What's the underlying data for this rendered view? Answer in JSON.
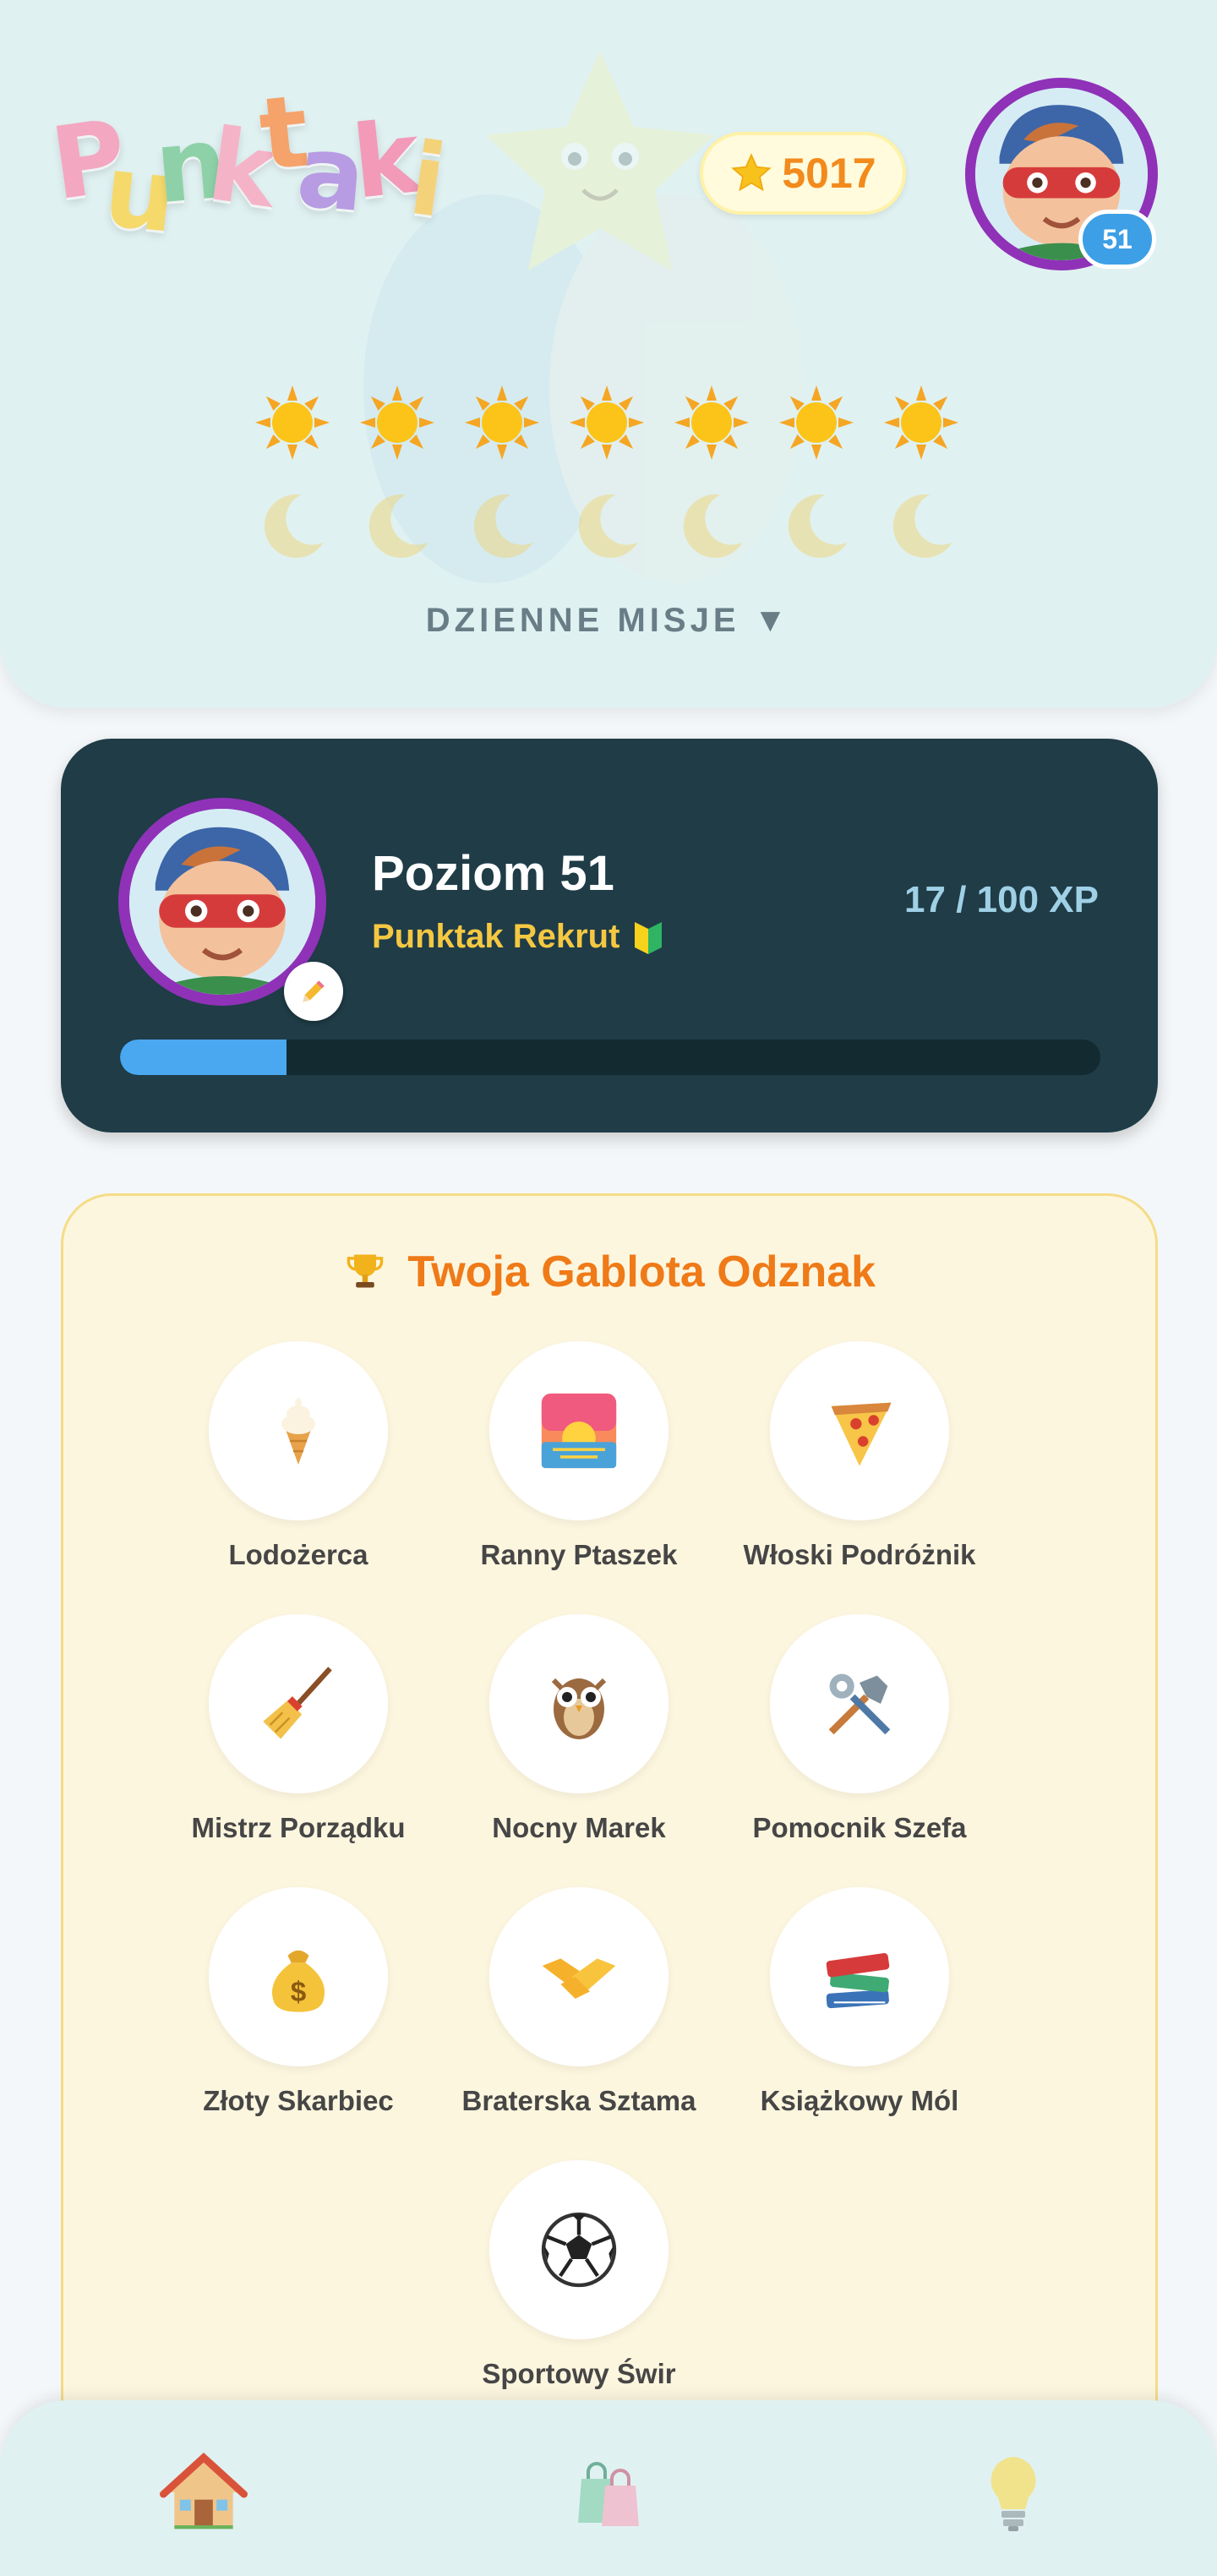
{
  "app": {
    "logo_text": "Punktaki"
  },
  "header": {
    "stars_value": "5017",
    "avatar_level": "51",
    "days_count": 7,
    "missions_label": "DZIENNE MISJE ▼"
  },
  "level_card": {
    "level_label": "Poziom 51",
    "rank_label": "Punktak Rekrut",
    "xp_label": "17 / 100 XP",
    "xp_progress": 0.17
  },
  "badges": {
    "title": "Twoja Gablota Odznak",
    "items": [
      {
        "label": "Lodożerca",
        "icon": "ice-cream-icon"
      },
      {
        "label": "Ranny Ptaszek",
        "icon": "sunrise-icon"
      },
      {
        "label": "Włoski Podróżnik",
        "icon": "pizza-icon"
      },
      {
        "label": "Mistrz Porządku",
        "icon": "broom-icon"
      },
      {
        "label": "Nocny Marek",
        "icon": "owl-icon"
      },
      {
        "label": "Pomocnik Szefa",
        "icon": "tools-icon"
      },
      {
        "label": "Złoty Skarbiec",
        "icon": "money-bag-icon"
      },
      {
        "label": "Braterska Sztama",
        "icon": "handshake-icon"
      },
      {
        "label": "Książkowy Mól",
        "icon": "books-icon"
      },
      {
        "label": "Sportowy Świr",
        "icon": "soccer-ball-icon"
      }
    ]
  },
  "nav": {
    "items": [
      {
        "icon": "home-icon"
      },
      {
        "icon": "shopping-bags-icon"
      },
      {
        "icon": "lightbulb-icon"
      }
    ]
  },
  "colors": {
    "accent_orange": "#ef7a18",
    "xp_fill": "#4aa8f0",
    "card_dark": "#1f3c47",
    "rank_yellow": "#f5c842",
    "avatar_ring": "#8f32b8"
  }
}
